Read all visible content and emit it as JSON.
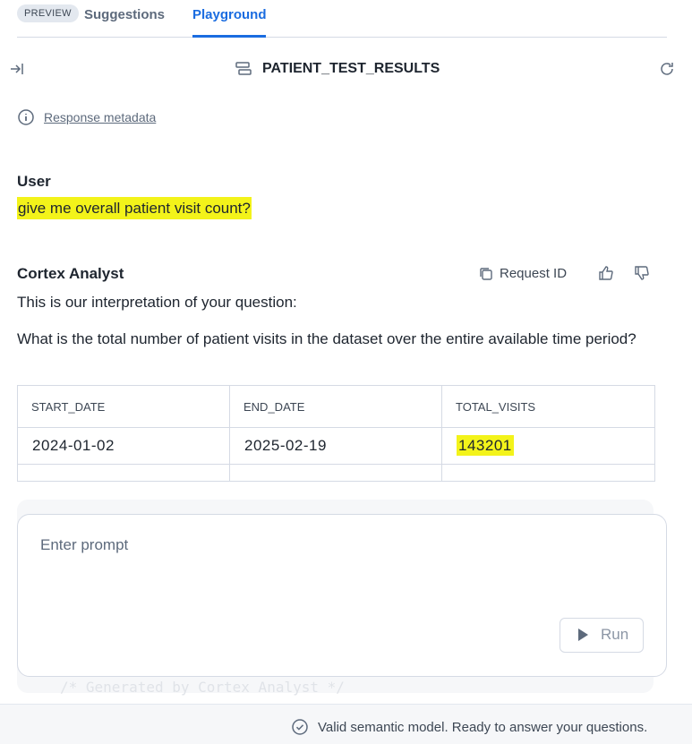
{
  "tabs": {
    "badge": "PREVIEW",
    "suggestions": "Suggestions",
    "playground": "Playground"
  },
  "header": {
    "title": "PATIENT_TEST_RESULTS",
    "icons": [
      "collapse-panel-icon",
      "table-icon",
      "refresh-icon"
    ]
  },
  "metadata": {
    "label": "Response metadata"
  },
  "user": {
    "label": "User",
    "message": "give me overall patient visit count?"
  },
  "analyst": {
    "label": "Cortex Analyst",
    "request_id": "Request ID",
    "intro": "This is our interpretation of your question:",
    "interpretation": "What is the total number of patient visits in the dataset over the entire available time period?"
  },
  "results": {
    "headers": [
      "START_DATE",
      "END_DATE",
      "TOTAL_VISITS"
    ],
    "rows": [
      [
        "2024-01-02",
        "2025-02-19",
        "143201"
      ]
    ]
  },
  "code_snippet": "/* Generated by Cortex Analyst */",
  "prompt": {
    "placeholder": "Enter prompt",
    "run_label": "Run"
  },
  "status": {
    "message": "Valid semantic model. Ready to answer your questions."
  },
  "colors": {
    "accent": "#1a6ce0",
    "highlight": "#f3f31a"
  }
}
